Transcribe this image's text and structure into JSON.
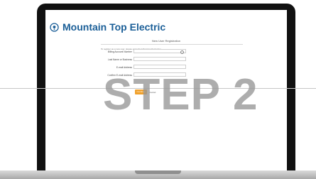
{
  "brand": {
    "name": "Mountain Top Electric",
    "color": "#1a5e97",
    "icon": "lightbulb-icon"
  },
  "form": {
    "title": "New User Registration",
    "intro": "To register as a new user, please enter the following information.",
    "fields": [
      {
        "label": "Billing Account Number",
        "value": "",
        "help_icon": "help-icon"
      },
      {
        "label": "Last Name or Business",
        "value": ""
      },
      {
        "label": "E-mail Address",
        "value": ""
      },
      {
        "label": "Confirm E-mail Address",
        "value": ""
      }
    ],
    "continue_label": "Continue",
    "cancel_label": "Cancel",
    "accent_color": "#f0a12c"
  },
  "overlay": {
    "text": "STEP 2"
  }
}
